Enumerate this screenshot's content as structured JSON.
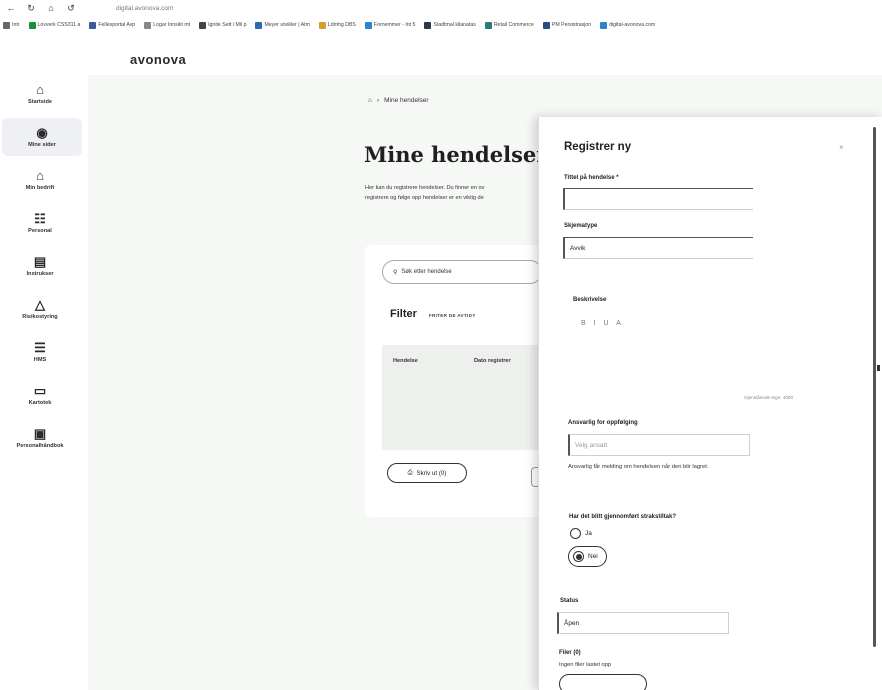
{
  "browser": {
    "nav": [
      "←",
      "↻",
      "⌂",
      "↺"
    ],
    "url": "digital.avonova.com"
  },
  "bookmarks": [
    {
      "label": "Intr",
      "color": "#666666"
    },
    {
      "label": "Lovverk CSS311 a",
      "color": "#1e8e3e"
    },
    {
      "label": "Fellesportal Avp",
      "color": "#3a5a9b"
    },
    {
      "label": "Logar Innsikt mt",
      "color": "#888888"
    },
    {
      "label": "Ignite Sett i Mil p",
      "color": "#444444"
    },
    {
      "label": "Meyer utvikler | Atm",
      "color": "#2b6cb0"
    },
    {
      "label": "Ldmhg DBS",
      "color": "#d69e2e"
    },
    {
      "label": "Fornemmer - Int 5",
      "color": "#3182ce"
    },
    {
      "label": "Stadtmal kilanatas",
      "color": "#2d3748"
    },
    {
      "label": "Retail Commerce",
      "color": "#2c7a7b"
    },
    {
      "label": "PM Persistrasjon",
      "color": "#2b4c7e"
    },
    {
      "label": "digital-avonova.com",
      "color": "#3182ce"
    }
  ],
  "brand": "avonova",
  "sidebar": [
    {
      "label": "Startside",
      "icon": "⌂",
      "icon_name": "home-icon",
      "active": false
    },
    {
      "label": "Mine sider",
      "icon": "◉",
      "icon_name": "user-icon",
      "active": true
    },
    {
      "label": "Min bedrift",
      "icon": "⌂",
      "icon_name": "company-icon",
      "active": false
    },
    {
      "label": "Personal",
      "icon": "☷",
      "icon_name": "people-icon",
      "active": false
    },
    {
      "label": "Instrukser",
      "icon": "▤",
      "icon_name": "instructions-icon",
      "active": false
    },
    {
      "label": "Risikostyring",
      "icon": "△",
      "icon_name": "risk-icon",
      "active": false
    },
    {
      "label": "HMS",
      "icon": "☰",
      "icon_name": "hms-icon",
      "active": false
    },
    {
      "label": "Kartotek",
      "icon": "▭",
      "icon_name": "folder-icon",
      "active": false
    },
    {
      "label": "Personalhåndbok",
      "icon": "▣",
      "icon_name": "handbook-icon",
      "active": false
    }
  ],
  "main": {
    "breadcrumb_current": "Mine hendelser",
    "title": "Mine hendelser",
    "intro_line1": "Her kan du registrere hendelser. Du finner en ov",
    "intro_line2": "registrere og følge opp hendelser er en viktig de",
    "search_placeholder": "Søk etter hendelse",
    "filter_title": "Filter",
    "filter_reset": "FRITER DE AVTIDY",
    "table_headers": [
      "Hendelse",
      "Dato registrer"
    ],
    "print_label": "Skriv ut (0)"
  },
  "panel": {
    "title": "Registrer ny",
    "title_field_label": "Tittel på hendelse *",
    "title_field_value": "",
    "schema_label": "Skjematype",
    "schema_value": "Avvik",
    "description_label": "Beskrivelse",
    "editor_tools": "B I U A",
    "char_count": "Gjenstående tegn: 4000",
    "responsible_label": "Ansvarlig for oppfølging",
    "responsible_placeholder": "Velg ansatt",
    "responsible_help": "Ansvarlig får melding om hendelsen når den blir lagret.",
    "question": "Har det blitt gjennomført strakstiltak?",
    "options": [
      {
        "label": "Ja",
        "selected": false
      },
      {
        "label": "Nei",
        "selected": true
      }
    ],
    "status_label": "Status",
    "status_value": "Åpen",
    "files_label": "Filer (0)",
    "files_help": "Ingen filer lastet opp"
  }
}
